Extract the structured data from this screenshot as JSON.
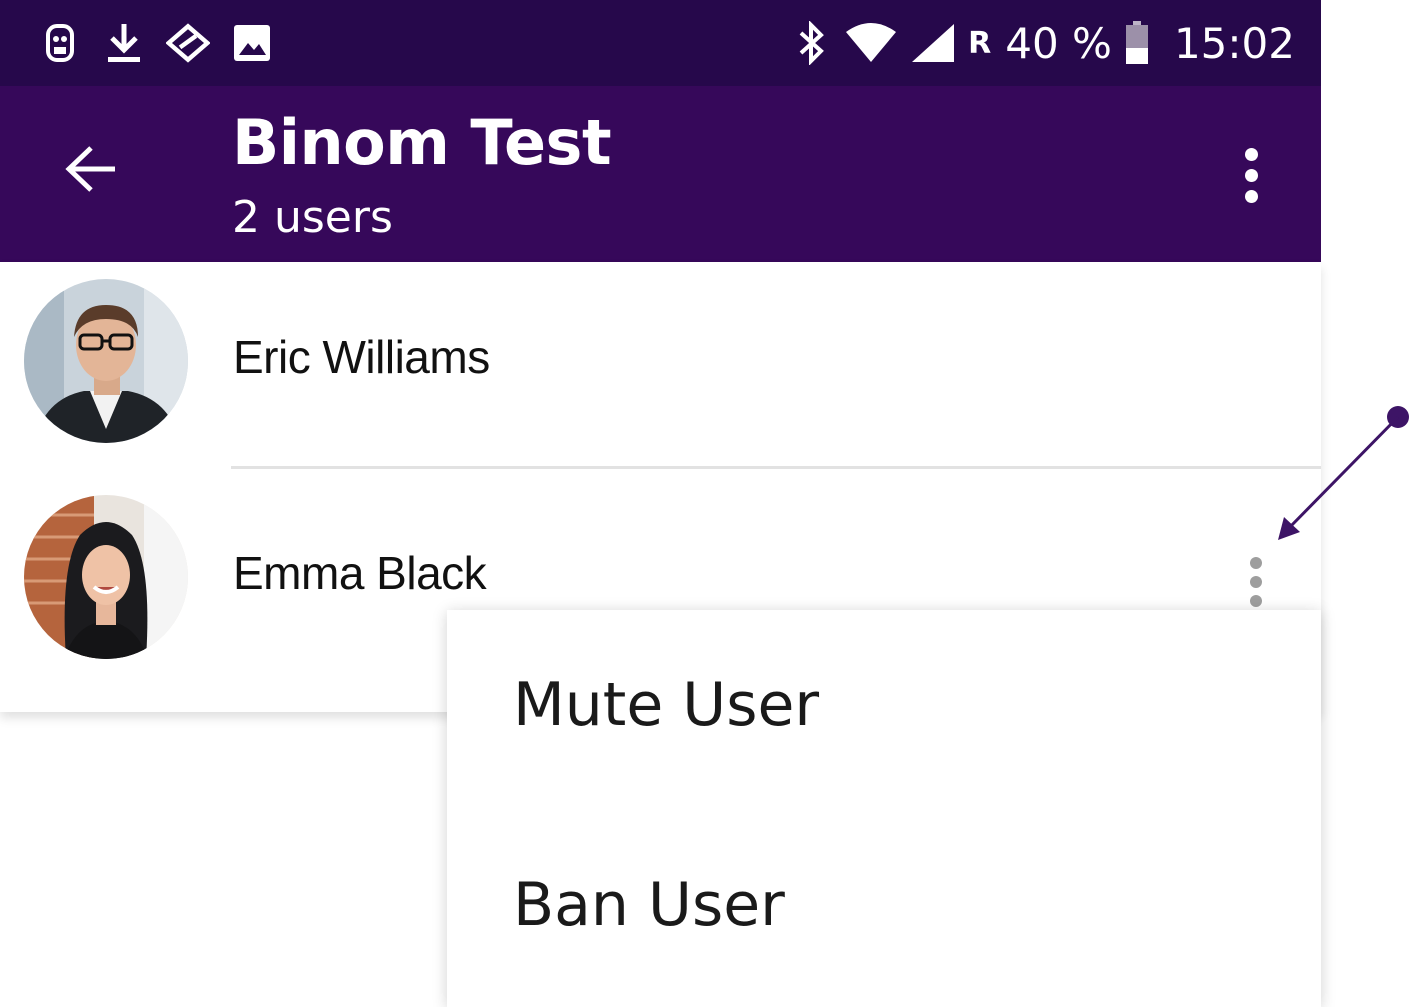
{
  "status_bar": {
    "icons": [
      "app-notification-icon",
      "download-icon",
      "sync-icon",
      "image-icon"
    ],
    "right_icons": [
      "bluetooth-icon",
      "wifi-icon",
      "cell-signal-icon"
    ],
    "roaming": "R",
    "battery_percent": "40 %",
    "battery_level": 0.4,
    "time": "15:02"
  },
  "app_bar": {
    "title": "Binom Test",
    "subtitle": "2 users",
    "back_icon": "arrow-back-icon",
    "overflow_icon": "more-vert-icon"
  },
  "users": [
    {
      "name": "Eric Williams"
    },
    {
      "name": "Emma Black"
    }
  ],
  "context_menu": {
    "items": [
      {
        "label": "Mute User"
      },
      {
        "label": "Ban User"
      }
    ]
  },
  "colors": {
    "status_bar": "#26084b",
    "app_bar": "#36085a",
    "annotation": "#3d1466"
  }
}
